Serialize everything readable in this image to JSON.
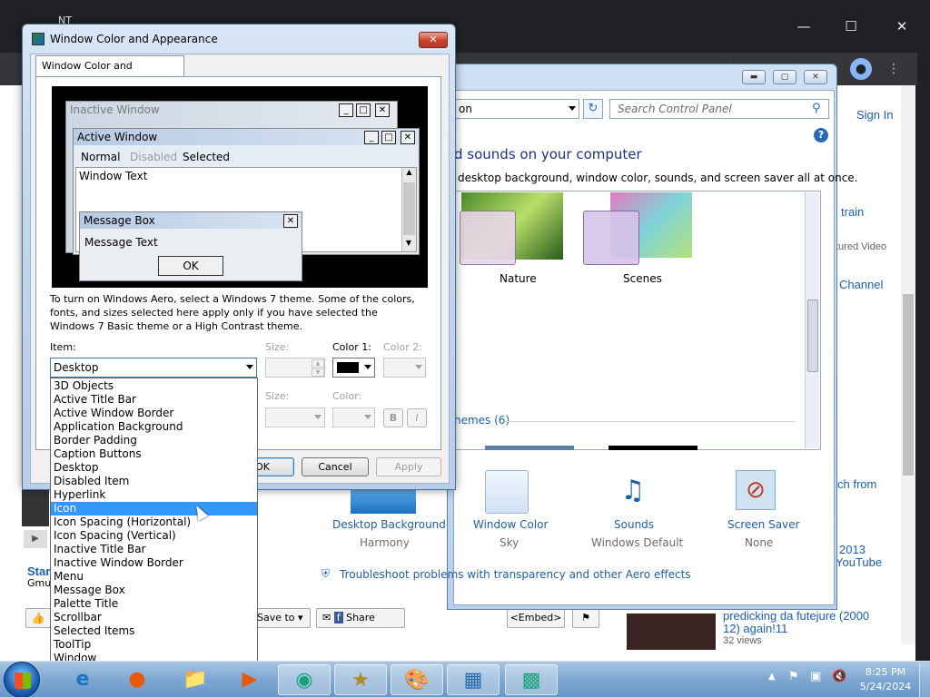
{
  "browser": {
    "tab_title": "NT",
    "sign_in": "Sign In",
    "right_items": [
      "train",
      "tured Video",
      "Channel",
      "ch from",
      "2013",
      "YouTube"
    ],
    "video_title": "predicking da futejure (2000 12) again!11",
    "video_views": "32 views",
    "left_text": [
      "Star",
      "Gmu"
    ],
    "action_save": "Save to",
    "action_share": "Share",
    "action_embed": "<Embed>"
  },
  "control_panel": {
    "address_text": "on",
    "search_placeholder": "Search Control Panel",
    "heading": "d sounds on your computer",
    "subheading": "desktop background, window color, sounds, and screen saver all at once.",
    "themes": [
      {
        "label": "Nature"
      },
      {
        "label": "Scenes"
      }
    ],
    "basic_themes_link": "hemes (6)",
    "bottom_items": [
      {
        "label": "Desktop Background",
        "value": "Harmony"
      },
      {
        "label": "Window Color",
        "value": "Sky"
      },
      {
        "label": "Sounds",
        "value": "Windows Default"
      },
      {
        "label": "Screen Saver",
        "value": "None"
      }
    ],
    "troubleshoot": "Troubleshoot problems with transparency and other Aero effects"
  },
  "dialog": {
    "title": "Window Color and Appearance",
    "tab": "Window Color and Appearance",
    "preview": {
      "inactive_window": "Inactive Window",
      "active_window": "Active Window",
      "menu_normal": "Normal",
      "menu_disabled": "Disabled",
      "menu_selected": "Selected",
      "window_text": "Window Text",
      "message_box": "Message Box",
      "message_text": "Message Text",
      "ok": "OK"
    },
    "info": "To turn on Windows Aero, select a Windows 7 theme.  Some of the colors, fonts, and sizes selected here apply only if you have selected the Windows 7 Basic theme or a High Contrast theme.",
    "item_label": "Item:",
    "item_value": "Desktop",
    "size_label": "Size:",
    "color1_label": "Color 1:",
    "color2_label": "Color 2:",
    "font_size_label": "Size:",
    "font_color_label": "Color:",
    "bold": "B",
    "italic": "I",
    "ok_button": "OK",
    "cancel_button": "Cancel",
    "apply_button": "Apply",
    "color1_swatch": "#000000"
  },
  "dropdown": {
    "highlighted": "Icon",
    "options": [
      "3D Objects",
      "Active Title Bar",
      "Active Window Border",
      "Application Background",
      "Border Padding",
      "Caption Buttons",
      "Desktop",
      "Disabled Item",
      "Hyperlink",
      "Icon",
      "Icon Spacing (Horizontal)",
      "Icon Spacing (Vertical)",
      "Inactive Title Bar",
      "Inactive Window Border",
      "Menu",
      "Message Box",
      "Palette Title",
      "Scrollbar",
      "Selected Items",
      "ToolTip",
      "Window"
    ]
  },
  "taskbar": {
    "time": "8:25 PM",
    "date": "5/24/2024"
  },
  "colors": {
    "highlight": "#3399ff",
    "accent_link": "#1a5fb4"
  }
}
